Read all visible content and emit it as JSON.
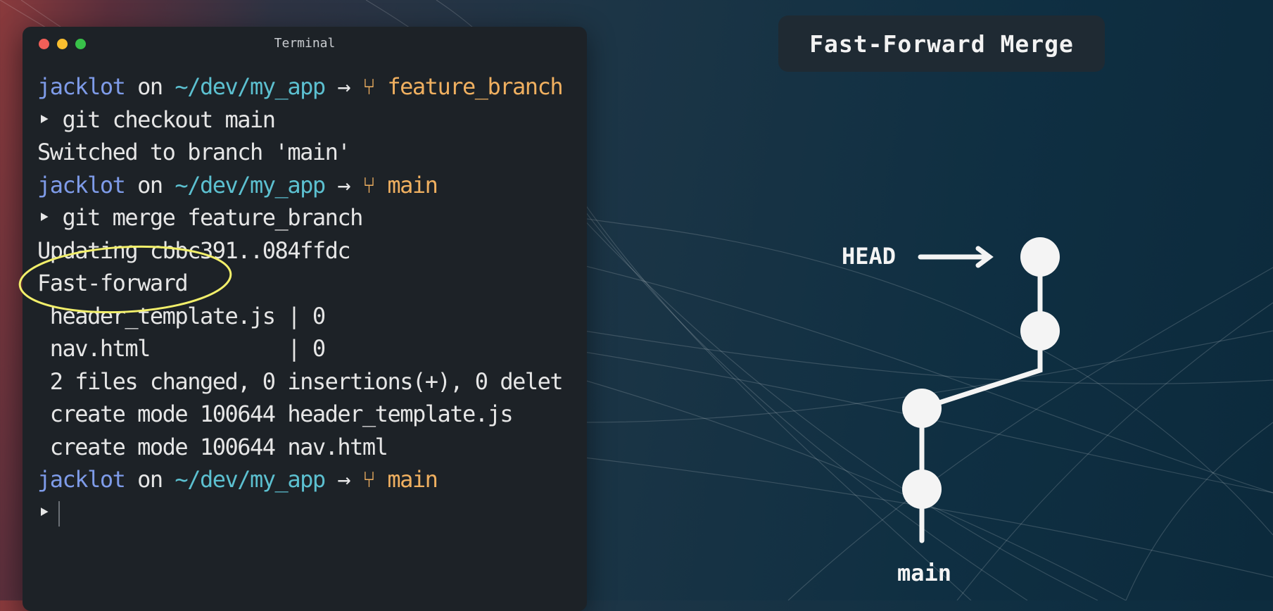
{
  "terminal": {
    "title": "Terminal",
    "lines": [
      {
        "type": "prompt",
        "user": "jacklot",
        "on": " on ",
        "path": "~/dev/my_app",
        "arrow": " → ",
        "branch_icon": "⑂",
        "branch": "feature_branch"
      },
      {
        "type": "cmd",
        "marker": "‣",
        "text": " git checkout main"
      },
      {
        "type": "out",
        "text": "Switched to branch 'main'"
      },
      {
        "type": "prompt",
        "user": "jacklot",
        "on": " on ",
        "path": "~/dev/my_app",
        "arrow": " → ",
        "branch_icon": "⑂",
        "branch": "main"
      },
      {
        "type": "cmd",
        "marker": "‣",
        "text": " git merge feature_branch"
      },
      {
        "type": "out",
        "text": "Updating cbbc391..084ffdc"
      },
      {
        "type": "out",
        "text": "Fast-forward"
      },
      {
        "type": "out",
        "text": " header_template.js | 0"
      },
      {
        "type": "out",
        "text": " nav.html           | 0"
      },
      {
        "type": "out",
        "text": " 2 files changed, 0 insertions(+), 0 delet"
      },
      {
        "type": "out",
        "text": " create mode 100644 header_template.js"
      },
      {
        "type": "out",
        "text": " create mode 100644 nav.html"
      },
      {
        "type": "prompt",
        "user": "jacklot",
        "on": " on ",
        "path": "~/dev/my_app",
        "arrow": " → ",
        "branch_icon": "⑂",
        "branch": "main"
      },
      {
        "type": "input",
        "marker": "‣"
      }
    ]
  },
  "diagram": {
    "title": "Fast-Forward Merge",
    "head_label": "HEAD",
    "branch_label": "main"
  },
  "colors": {
    "user": "#7e9be8",
    "path": "#5cc0d0",
    "branch": "#f0b060",
    "highlight": "#f2ef6a"
  },
  "icons": [
    "close-dot",
    "minimize-dot",
    "maximize-dot",
    "git-branch-icon",
    "prompt-arrow-icon",
    "head-arrow-icon"
  ]
}
